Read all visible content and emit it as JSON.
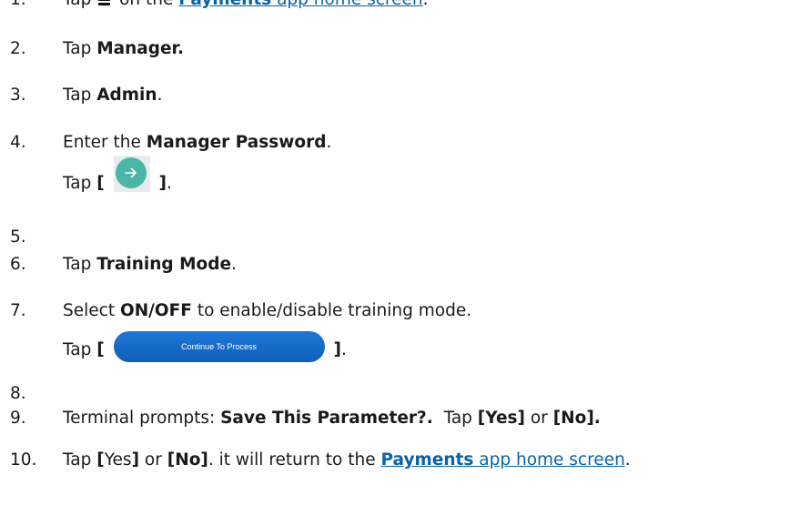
{
  "steps": [
    {
      "num": "1.",
      "pre": "Tap",
      "post": "on the",
      "link_bold": "Payments",
      "link_rest": "app home screen",
      "end": "."
    },
    {
      "num": "2.",
      "pre": "Tap",
      "bold": "Manager."
    },
    {
      "num": "3.",
      "pre": "Tap",
      "bold": "Admin",
      "end": "."
    },
    {
      "num": "4.",
      "pre": "Enter the",
      "bold": "Manager Password",
      "end": "."
    },
    {
      "num": "5.",
      "pre": "Tap",
      "bracket_open": "[",
      "bracket_close": "]",
      "end": ".",
      "icon": "arrow-right-circle-icon"
    },
    {
      "num": "6.",
      "pre": "Tap",
      "bold": "Training Mode",
      "end": "."
    },
    {
      "num": "7.",
      "pre": "Select",
      "bold": "ON/OFF",
      "post": "to enable/disable training mode."
    },
    {
      "num": "8.",
      "pre": "Tap",
      "bracket_open": "[",
      "bracket_close": "]",
      "end": ".",
      "button_label": "Continue To Process"
    },
    {
      "num": "9.",
      "pre": "Terminal prompts:",
      "bold": "Save This Parameter?.",
      "mid": "Tap",
      "yes": "[Yes]",
      "or": "or",
      "no": "[No]."
    },
    {
      "num": "10.",
      "pre": "Tap",
      "yes_open": "[",
      "yes_text": "Yes",
      "yes_close": "]",
      "or": "or",
      "no": "[No]",
      "post": ". it will return to the",
      "link_bold": "Payments",
      "link_rest": "app home screen",
      "end": "."
    }
  ],
  "colors": {
    "link": "#0b63a6",
    "button": "#1668c7",
    "arrow_circle": "#4bb6a7"
  }
}
